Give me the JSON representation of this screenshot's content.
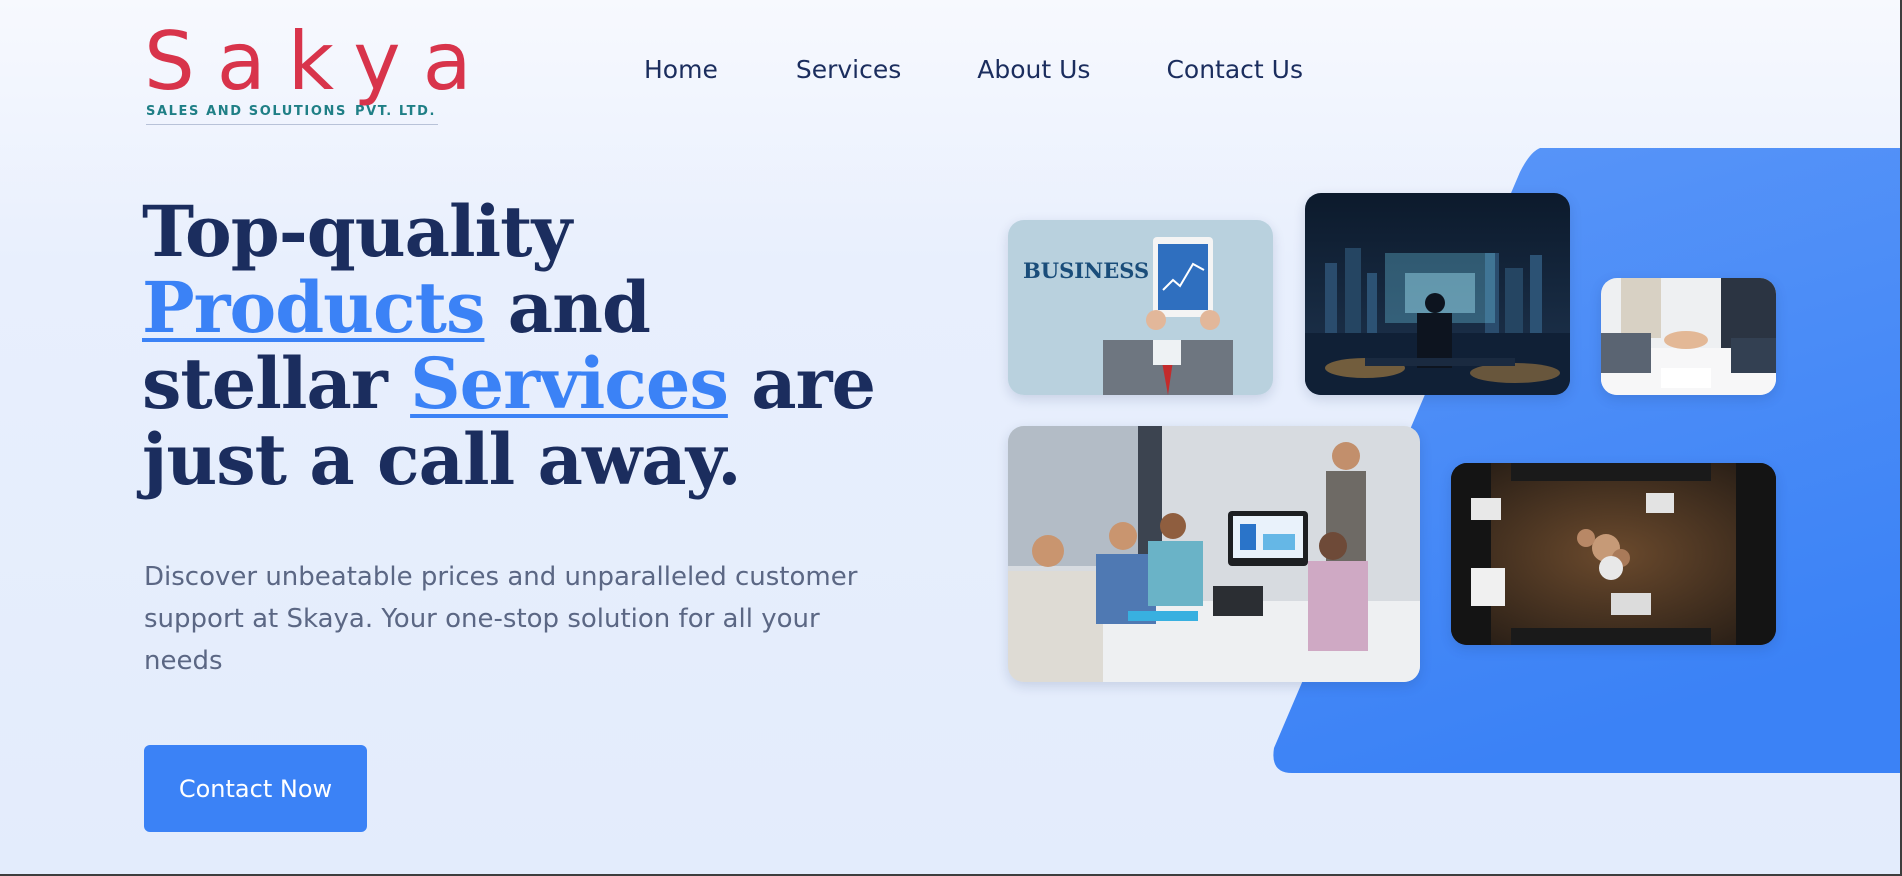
{
  "brand": {
    "name": "Sakya",
    "tagline_left": "SALES AND SOLUTIONS",
    "tagline_right": "PVT. LTD.",
    "color": "#d8344b",
    "tagline_color": "#1f7f86"
  },
  "nav": {
    "items": [
      {
        "label": "Home"
      },
      {
        "label": "Services"
      },
      {
        "label": "About Us"
      },
      {
        "label": "Contact Us"
      }
    ]
  },
  "hero": {
    "title_line1": "Top-quality",
    "title_products": "Products",
    "title_and": " and",
    "title_stellar": "stellar ",
    "title_services": "Services",
    "title_are": " are",
    "title_line4": "just a call away.",
    "subtitle": "Discover unbeatable prices and unparalleled customer support at Skaya. Your one-stop solution for all your needs",
    "cta_label": "Contact Now"
  },
  "images": {
    "tile1_text": "BUSINESS"
  },
  "colors": {
    "accent": "#3b82f6",
    "heading": "#1b2d5e",
    "body_text": "#5b6784"
  }
}
